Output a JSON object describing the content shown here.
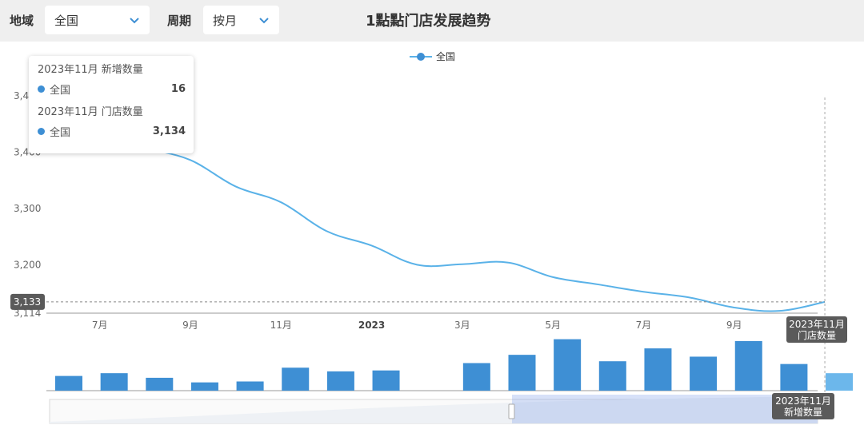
{
  "filters": {
    "region_label": "地域",
    "region_value": "全国",
    "period_label": "周期",
    "period_value": "按月"
  },
  "title": "1點點门店发展趋势",
  "icons": {
    "dropdown": "chevron-down-icon"
  },
  "colors": {
    "line": "#5ab2e8",
    "bar": "#3e8fd4",
    "bar_highlight": "#6cb7eb",
    "axis_text": "#666666"
  },
  "tooltip": {
    "header_new": "2023年11月 新增数量",
    "series_name_1": "全国",
    "value_new": "16",
    "header_total": "2023年11月 门店数量",
    "series_name_2": "全国",
    "value_total": "3,134"
  },
  "axis_pointer": {
    "y_label": "3,133",
    "x_label_top": "2023年11月\n门店数量",
    "x_label_bottom": "2023年11月\n新增数量"
  },
  "chart_data": [
    {
      "type": "line",
      "title": "门店数量",
      "legend": "全国",
      "legend_position": "top-center",
      "months": [
        "2022-06",
        "2022-07",
        "2022-08",
        "2022-09",
        "2022-10",
        "2022-11",
        "2022-12",
        "2023-01",
        "2023-02",
        "2023-03",
        "2023-04",
        "2023-05",
        "2023-06",
        "2023-07",
        "2023-08",
        "2023-09",
        "2023-10",
        "2023-11"
      ],
      "x_tick_labels": [
        {
          "month": "2022-07",
          "label": "7月"
        },
        {
          "month": "2022-09",
          "label": "9月"
        },
        {
          "month": "2022-11",
          "label": "11月"
        },
        {
          "month": "2023-01",
          "label": "2023"
        },
        {
          "month": "2023-03",
          "label": "3月"
        },
        {
          "month": "2023-05",
          "label": "5月"
        },
        {
          "month": "2023-07",
          "label": "7月"
        },
        {
          "month": "2023-09",
          "label": "9月"
        }
      ],
      "series": [
        {
          "name": "全国",
          "values": [
            3460,
            3437,
            3408,
            3386,
            3339,
            3311,
            3260,
            3234,
            3200,
            3201,
            3204,
            3178,
            3165,
            3152,
            3142,
            3124,
            3118,
            3134
          ]
        }
      ],
      "yticks": [
        "3,114",
        "3,200",
        "3,300",
        "3,400",
        "3,4"
      ],
      "ytick_values": [
        3114,
        3200,
        3300,
        3400,
        3500
      ],
      "ylim": [
        3114,
        3500
      ],
      "grid": false
    },
    {
      "type": "bar",
      "title": "新增数量",
      "months": [
        "2022-06",
        "2022-07",
        "2022-08",
        "2022-09",
        "2022-10",
        "2022-11",
        "2022-12",
        "2023-01",
        "2023-02",
        "2023-03",
        "2023-04",
        "2023-05",
        "2023-06",
        "2023-07",
        "2023-08",
        "2023-09",
        "2023-10",
        "2023-11"
      ],
      "series": [
        {
          "name": "全国",
          "values": [
            16,
            19,
            14,
            9,
            10,
            25,
            21,
            22,
            null,
            30,
            39,
            56,
            32,
            46,
            37,
            54,
            29,
            19
          ]
        }
      ],
      "ylim": [
        0,
        60
      ]
    }
  ]
}
